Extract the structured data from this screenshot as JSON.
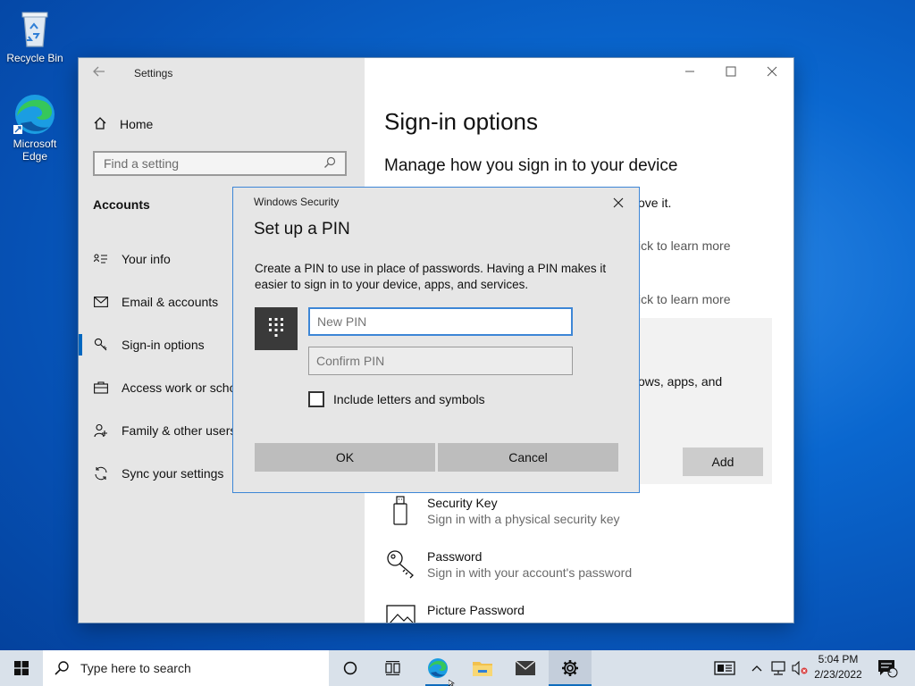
{
  "desktop": {
    "icons": [
      {
        "label": "Recycle Bin"
      },
      {
        "label": "Microsoft Edge"
      }
    ]
  },
  "settings": {
    "title": "Settings",
    "home": "Home",
    "search_placeholder": "Find a setting",
    "section": "Accounts",
    "nav": [
      {
        "label": "Your info",
        "icon": "person-card-icon"
      },
      {
        "label": "Email & accounts",
        "icon": "mail-icon"
      },
      {
        "label": "Sign-in options",
        "icon": "key-icon",
        "selected": true
      },
      {
        "label": "Access work or school",
        "icon": "briefcase-icon"
      },
      {
        "label": "Family & other users",
        "icon": "person-add-icon"
      },
      {
        "label": "Sync your settings",
        "icon": "sync-icon"
      }
    ],
    "content": {
      "heading": "Sign-in options",
      "subheading": "Manage how you sign in to your device",
      "frag1": "ove it.",
      "frag2": "ick to learn more",
      "frag3": "ick to learn more",
      "frag4": "ows, apps, and",
      "add_label": "Add",
      "options": [
        {
          "title": "Security Key",
          "sub": "Sign in with a physical security key",
          "icon": "usb-key-icon"
        },
        {
          "title": "Password",
          "sub": "Sign in with your account's password",
          "icon": "key-icon"
        },
        {
          "title": "Picture Password",
          "sub": "",
          "icon": "picture-icon"
        }
      ]
    }
  },
  "dialog": {
    "title": "Windows Security",
    "heading": "Set up a PIN",
    "description": "Create a PIN to use in place of passwords. Having a PIN makes it easier to sign in to your device, apps, and services.",
    "new_pin_placeholder": "New PIN",
    "confirm_pin_placeholder": "Confirm PIN",
    "checkbox_label": "Include letters and symbols",
    "checkbox_checked": false,
    "ok": "OK",
    "cancel": "Cancel"
  },
  "taskbar": {
    "search_placeholder": "Type here to search",
    "time": "5:04 PM",
    "date": "2/23/2022",
    "notification_count": "1"
  },
  "colors": {
    "accent": "#0067c0",
    "dialog_border": "#3d86d6"
  }
}
